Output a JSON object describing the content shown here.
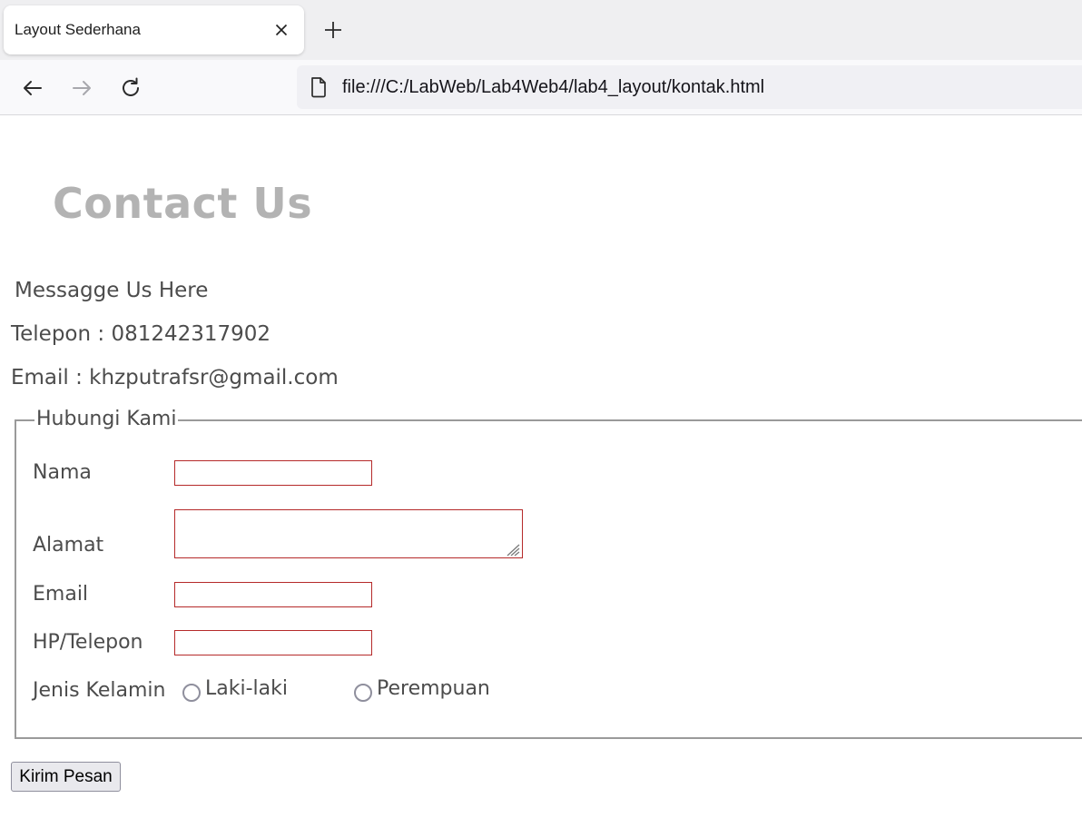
{
  "browser": {
    "tab_title": "Layout Sederhana",
    "url": "file:///C:/LabWeb/Lab4Web4/lab4_layout/kontak.html",
    "icons": {
      "close": "close-icon",
      "new_tab": "plus-icon",
      "back": "back-arrow-icon",
      "forward": "forward-arrow-icon",
      "reload": "reload-icon",
      "page": "page-icon"
    }
  },
  "page": {
    "heading": "Contact Us",
    "message_line": "Messagge Us Here",
    "phone_line": "Telepon : 081242317902",
    "email_line": "Email : khzputrafsr@gmail.com"
  },
  "form": {
    "legend": "Hubungi Kami",
    "fields": {
      "nama": {
        "label": "Nama",
        "value": ""
      },
      "alamat": {
        "label": "Alamat",
        "value": ""
      },
      "email": {
        "label": "Email",
        "value": ""
      },
      "telepon": {
        "label": "HP/Telepon",
        "value": ""
      }
    },
    "gender": {
      "label": "Jenis Kelamin",
      "options": [
        "Laki-laki",
        "Perempuan"
      ],
      "selected": null
    },
    "submit_label": "Kirim Pesan"
  },
  "colors": {
    "heading": "#b3b3b3",
    "text": "#4c4c4c",
    "input_border": "#b52a2a",
    "tabstrip_bg": "#efeff1",
    "urlbar_bg": "#f0f0f4"
  }
}
